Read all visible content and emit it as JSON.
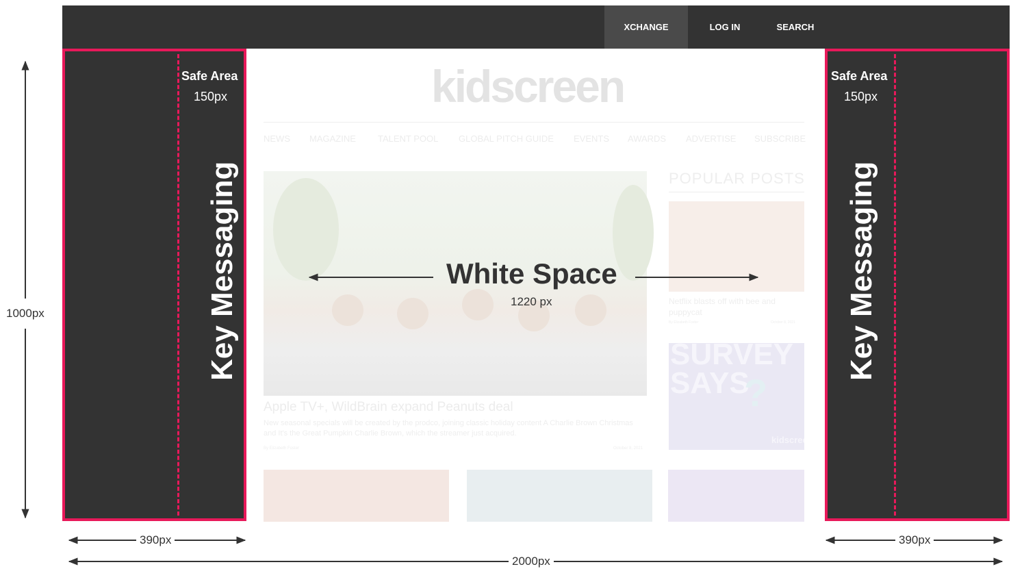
{
  "nav": {
    "items": [
      "XCHANGE",
      "LOG IN",
      "SEARCH"
    ]
  },
  "left_panel": {
    "safe_area_title": "Safe Area",
    "safe_area_size": "150px",
    "key_messaging": "Key Messaging",
    "width_label": "390px"
  },
  "right_panel": {
    "safe_area_title": "Safe Area",
    "safe_area_size": "150px",
    "key_messaging": "Key Messaging",
    "width_label": "390px"
  },
  "center": {
    "title": "White Space",
    "width_label": "1220 px"
  },
  "dimensions": {
    "height_label": "1000px",
    "total_width_label": "2000px"
  },
  "site": {
    "logo": "kidscreen",
    "menu": [
      "NEWS",
      "MAGAZINE",
      "TALENT POOL",
      "GLOBAL PITCH GUIDE",
      "EVENTS",
      "AWARDS",
      "ADVERTISE",
      "SUBSCRIBE"
    ],
    "headline": "Apple TV+, WildBrain expand Peanuts deal",
    "excerpt": "New seasonal specials will be created by the prodco, joining classic holiday content A Charlie Brown Christmas and It's the Great Pumpkin Charlie Brown, which the streamer just acquired.",
    "byline": "By Elizabeth Foster",
    "date": "October 8, 2021",
    "popular_heading": "POPULAR POSTS",
    "popular_title": "Netflix blasts off with bee and puppycat",
    "popular_byline": "By Elizabeth Foster",
    "popular_date": "October 8, 2021",
    "survey_text": "SURVEY SAYS",
    "survey_mark": "?",
    "survey_brand": "kidscreen"
  },
  "colors": {
    "dark_panel": "#333333",
    "accent_border": "#e8195a",
    "nav_active": "#4a4a4a"
  }
}
